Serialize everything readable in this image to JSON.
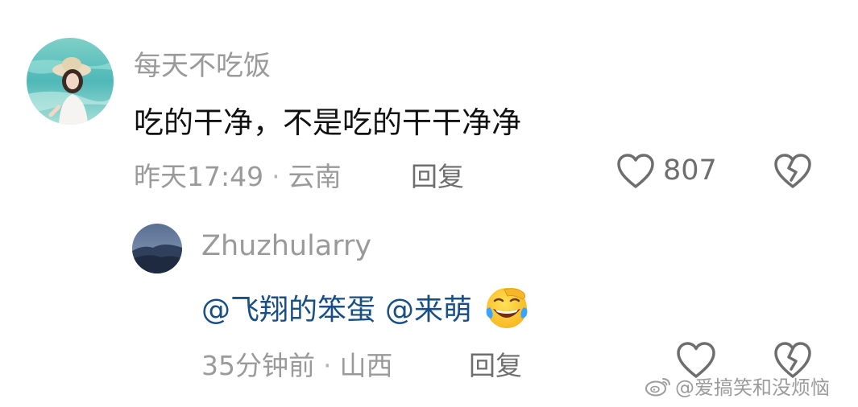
{
  "comment": {
    "username": "每天不吃饭",
    "text": "吃的干净，不是吃的干干净净",
    "time": "昨天17:49",
    "separator": "·",
    "location": "云南",
    "reply_label": "回复",
    "like_count": "807"
  },
  "reply": {
    "username": "Zhuzhularry",
    "mention_1": "@飞翔的笨蛋",
    "mention_2": "@来萌",
    "emoji": "laughing-crying-emoji",
    "time": "35分钟前",
    "separator": "·",
    "location": "山西",
    "reply_label": "回复"
  },
  "watermark": {
    "text": "@爱搞笑和没烦恼"
  },
  "colors": {
    "username": "#9a9a9a",
    "body": "#111111",
    "mention": "#1a4f86",
    "meta": "#9a9a9a",
    "action": "#6e6e6e"
  }
}
